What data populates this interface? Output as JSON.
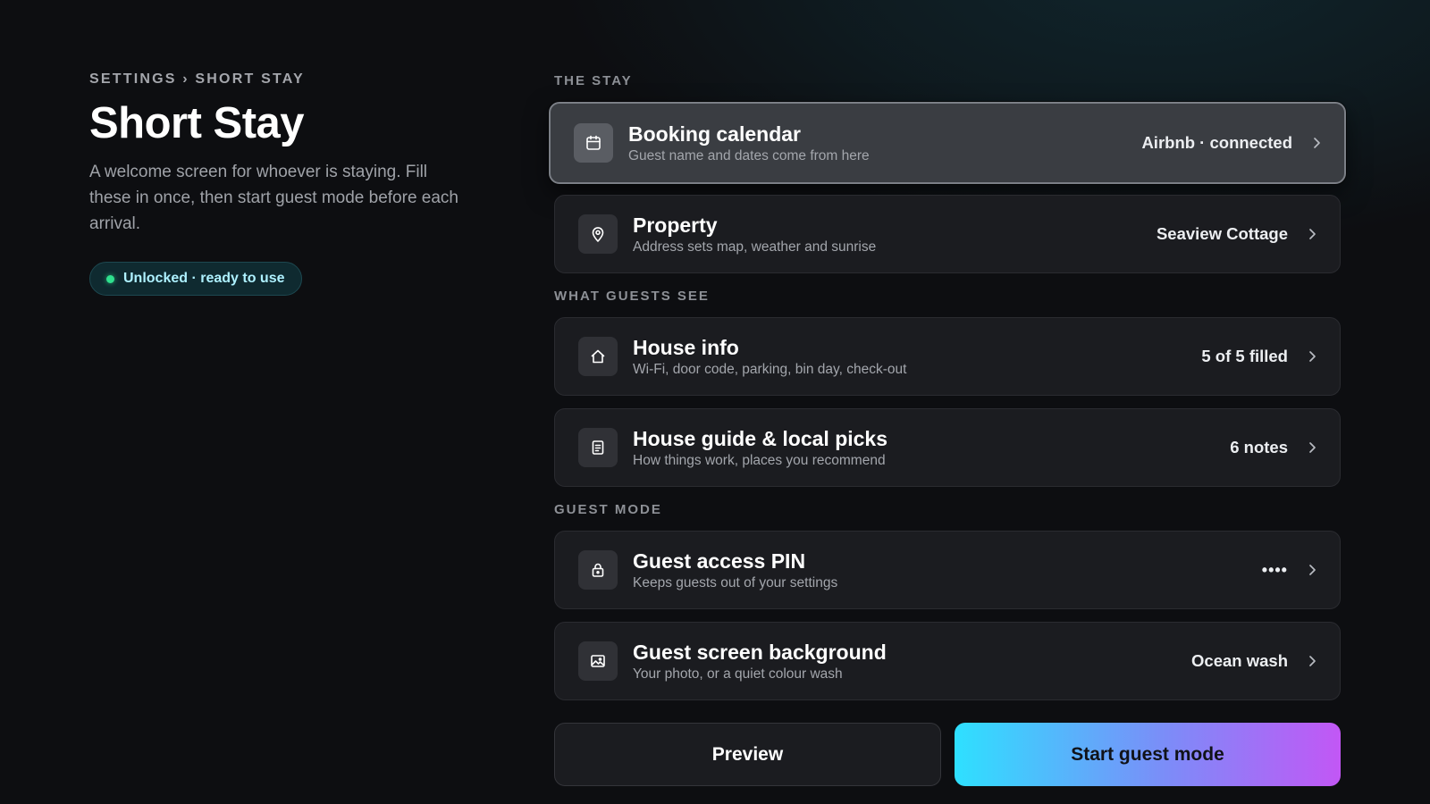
{
  "header": {
    "breadcrumb": "SETTINGS › SHORT STAY",
    "title": "Short Stay",
    "description": "A welcome screen for whoever is staying. Fill these in once, then start guest mode before each arrival.",
    "status": "Unlocked · ready to use"
  },
  "sections": {
    "stay_label": "THE STAY",
    "guests_label": "WHAT GUESTS SEE",
    "guest_mode_label": "GUEST MODE"
  },
  "rows": {
    "booking": {
      "title": "Booking calendar",
      "subtitle": "Guest name and dates come from here",
      "value": "Airbnb · connected",
      "icon": "calendar-icon"
    },
    "property": {
      "title": "Property",
      "subtitle": "Address sets map, weather and sunrise",
      "value": "Seaview Cottage",
      "icon": "map-pin-icon"
    },
    "house_info": {
      "title": "House info",
      "subtitle": "Wi-Fi, door code, parking, bin day, check-out",
      "value": "5 of 5 filled",
      "icon": "home-icon"
    },
    "house_guide": {
      "title": "House guide & local picks",
      "subtitle": "How things work, places you recommend",
      "value": "6 notes",
      "icon": "document-icon"
    },
    "pin": {
      "title": "Guest access PIN",
      "subtitle": "Keeps guests out of your settings",
      "value": "••••",
      "icon": "lock-icon"
    },
    "background": {
      "title": "Guest screen background",
      "subtitle": "Your photo, or a quiet colour wash",
      "value": "Ocean wash",
      "icon": "image-icon"
    }
  },
  "actions": {
    "preview_label": "Preview",
    "start_label": "Start guest mode"
  },
  "colors": {
    "background": "#0d0e11",
    "card": "#1b1c20",
    "focused_card": "#3a3d42",
    "status_dot": "#2fe08e",
    "gradient_start": "#2ee0ff",
    "gradient_end": "#c257f5"
  }
}
